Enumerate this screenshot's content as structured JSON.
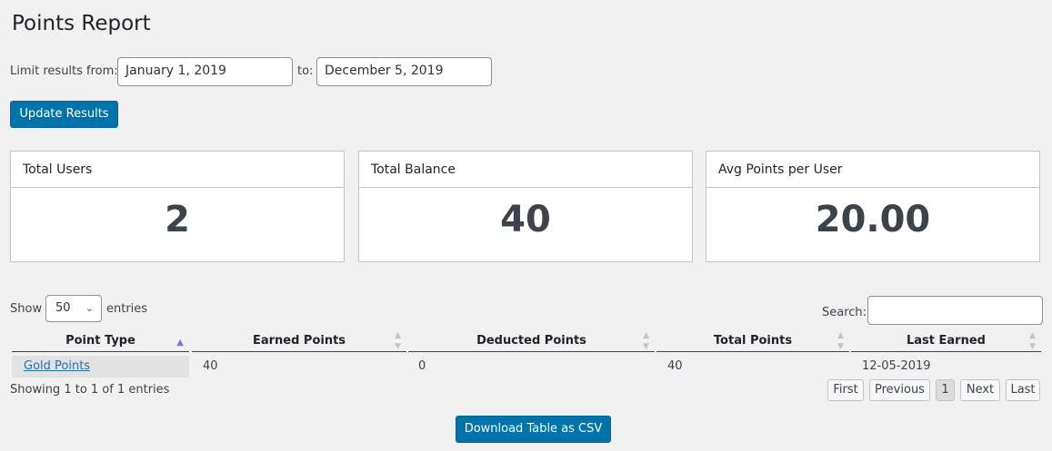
{
  "page": {
    "title": "Points Report"
  },
  "filter": {
    "from_label": "Limit results from:",
    "from_value": "January 1, 2019",
    "to_label": "to:",
    "to_value": "December 5, 2019",
    "update_label": "Update Results"
  },
  "stats": [
    {
      "title": "Total Users",
      "value": "2"
    },
    {
      "title": "Total Balance",
      "value": "40"
    },
    {
      "title": "Avg Points per User",
      "value": "20.00"
    }
  ],
  "table_controls": {
    "show_label": "Show",
    "entries_value": "50",
    "entries_label": "entries",
    "search_label": "Search:",
    "search_value": ""
  },
  "table": {
    "headers": [
      "Point Type",
      "Earned Points",
      "Deducted Points",
      "Total Points",
      "Last Earned"
    ],
    "rows": [
      [
        "Gold Points",
        "40",
        "0",
        "40",
        "12-05-2019"
      ]
    ]
  },
  "footer": {
    "info": "Showing 1 to 1 of 1 entries",
    "pagination": [
      "First",
      "Previous",
      "1",
      "Next",
      "Last"
    ],
    "download_label": "Download Table as CSV"
  }
}
